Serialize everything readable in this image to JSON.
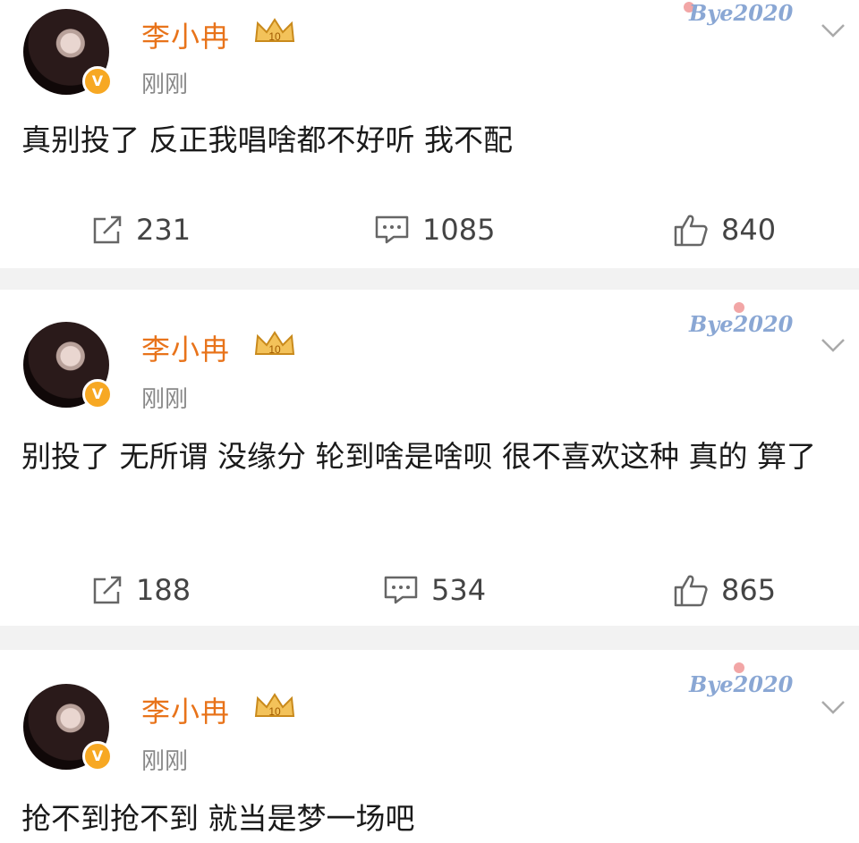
{
  "posts": [
    {
      "user": "李小冉",
      "time": "刚刚",
      "watermark": "Bye2020",
      "content": "真别投了 反正我唱啥都不好听 我不配",
      "repost_count": "231",
      "comment_count": "1085",
      "like_count": "840"
    },
    {
      "user": "李小冉",
      "time": "刚刚",
      "watermark": "Bye2020",
      "content": "别投了 无所谓 没缘分 轮到啥是啥呗 很不喜欢这种 真的 算了",
      "repost_count": "188",
      "comment_count": "534",
      "like_count": "865"
    },
    {
      "user": "李小冉",
      "time": "刚刚",
      "watermark": "Bye2020",
      "content": "抢不到抢不到 就当是梦一场吧"
    }
  ],
  "icons": {
    "verified": "verified-v-icon",
    "member": "crown-member-icon",
    "repost": "repost-icon",
    "comment": "comment-icon",
    "like": "thumbs-up-icon",
    "more": "chevron-down-icon"
  },
  "colors": {
    "username": "#e8731a",
    "verified": "#f7a823",
    "background": "#f2f2f2"
  }
}
